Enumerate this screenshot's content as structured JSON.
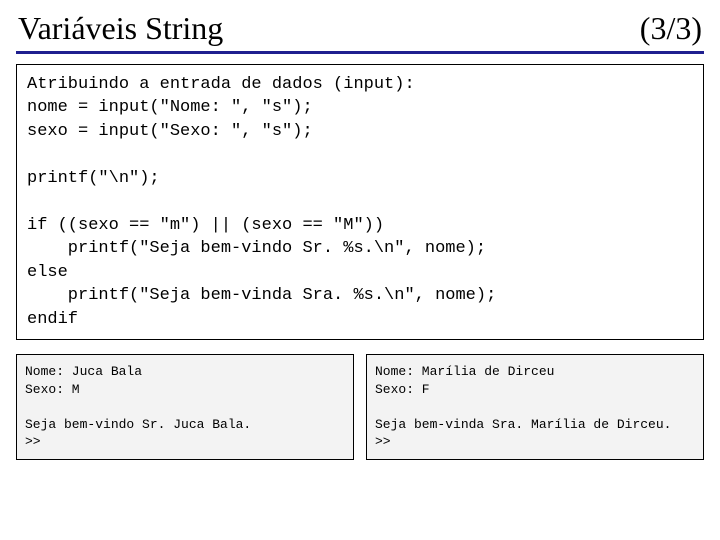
{
  "header": {
    "title": "Variáveis String",
    "page": "(3/3)"
  },
  "code": "Atribuindo a entrada de dados (input):\nnome = input(\"Nome: \", \"s\");\nsexo = input(\"Sexo: \", \"s\");\n\nprintf(\"\\n\");\n\nif ((sexo == \"m\") || (sexo == \"M\"))\n    printf(\"Seja bem-vindo Sr. %s.\\n\", nome);\nelse\n    printf(\"Seja bem-vinda Sra. %s.\\n\", nome);\nendif",
  "outputs": {
    "left": "Nome: Juca Bala\nSexo: M\n\nSeja bem-vindo Sr. Juca Bala.\n>>",
    "right": "Nome: Marília de Dirceu\nSexo: F\n\nSeja bem-vinda Sra. Marília de Dirceu.\n>>"
  }
}
